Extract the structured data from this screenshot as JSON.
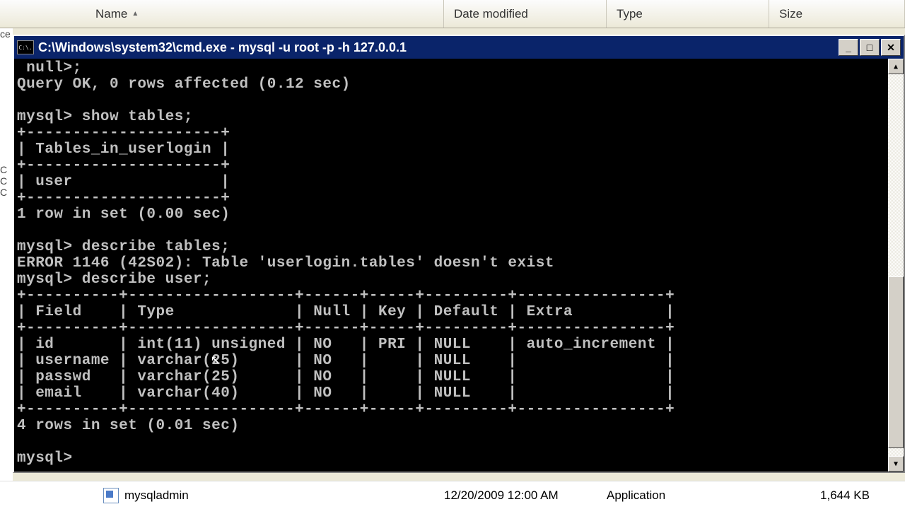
{
  "explorer": {
    "columns": {
      "name": "Name",
      "date": "Date modified",
      "type": "Type",
      "size": "Size"
    },
    "row": {
      "name": "mysqladmin",
      "date": "12/20/2009 12:00 AM",
      "type": "Application",
      "size": "1,644 KB"
    }
  },
  "cmd": {
    "title_icon": "C:\\.",
    "title": "C:\\Windows\\system32\\cmd.exe - mysql  -u root -p -h 127.0.0.1",
    "buttons": {
      "min": "_",
      "max": "□",
      "close": "✕"
    },
    "scroll": {
      "up": "▲",
      "down": "▼"
    },
    "terminal": " null>;\nQuery OK, 0 rows affected (0.12 sec)\n\nmysql> show tables;\n+---------------------+\n| Tables_in_userlogin |\n+---------------------+\n| user                |\n+---------------------+\n1 row in set (0.00 sec)\n\nmysql> describe tables;\nERROR 1146 (42S02): Table 'userlogin.tables' doesn't exist\nmysql> describe user;\n+----------+------------------+------+-----+---------+----------------+\n| Field    | Type             | Null | Key | Default | Extra          |\n+----------+------------------+------+-----+---------+----------------+\n| id       | int(11) unsigned | NO   | PRI | NULL    | auto_increment |\n| username | varchar(25)      | NO   |     | NULL    |                |\n| passwd   | varchar(25)      | NO   |     | NULL    |                |\n| email    | varchar(40)      | NO   |     | NULL    |                |\n+----------+------------------+------+-----+---------+----------------+\n4 rows in set (0.01 sec)\n\nmysql> "
  }
}
